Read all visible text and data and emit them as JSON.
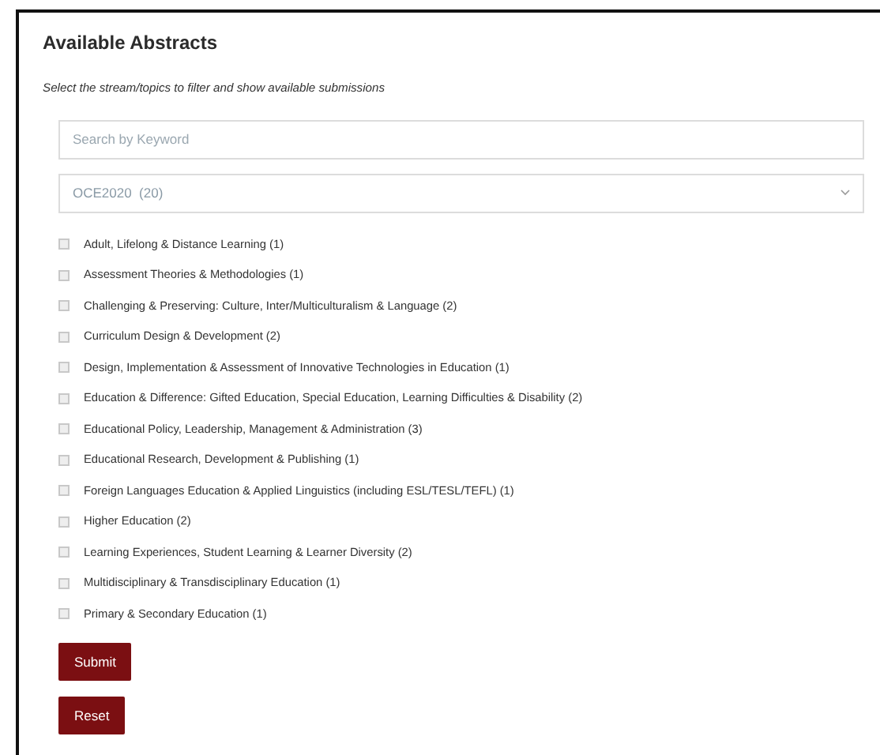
{
  "title": "Available Abstracts",
  "instructions": "Select the stream/topics to filter and show available submissions",
  "search": {
    "placeholder": "Search by Keyword"
  },
  "stream_select": {
    "value": "OCE2020  (20)"
  },
  "topics": [
    {
      "label": "Adult, Lifelong & Distance Learning (1)",
      "checked": false
    },
    {
      "label": "Assessment Theories & Methodologies (1)",
      "checked": false
    },
    {
      "label": "Challenging & Preserving: Culture, Inter/Multiculturalism & Language (2)",
      "checked": false
    },
    {
      "label": "Curriculum Design & Development (2)",
      "checked": false
    },
    {
      "label": "Design, Implementation & Assessment of Innovative Technologies in Education (1)",
      "checked": false
    },
    {
      "label": "Education & Difference: Gifted Education, Special Education, Learning Difficulties & Disability (2)",
      "checked": false
    },
    {
      "label": "Educational Policy, Leadership, Management & Administration (3)",
      "checked": false
    },
    {
      "label": "Educational Research, Development & Publishing (1)",
      "checked": false
    },
    {
      "label": "Foreign Languages Education & Applied Linguistics (including ESL/TESL/TEFL) (1)",
      "checked": false
    },
    {
      "label": "Higher Education (2)",
      "checked": false
    },
    {
      "label": "Learning Experiences, Student Learning & Learner Diversity (2)",
      "checked": false
    },
    {
      "label": "Multidisciplinary & Transdisciplinary Education (1)",
      "checked": false
    },
    {
      "label": "Primary & Secondary Education (1)",
      "checked": false
    }
  ],
  "buttons": [
    {
      "label": "Submit"
    },
    {
      "label": "Reset"
    }
  ]
}
